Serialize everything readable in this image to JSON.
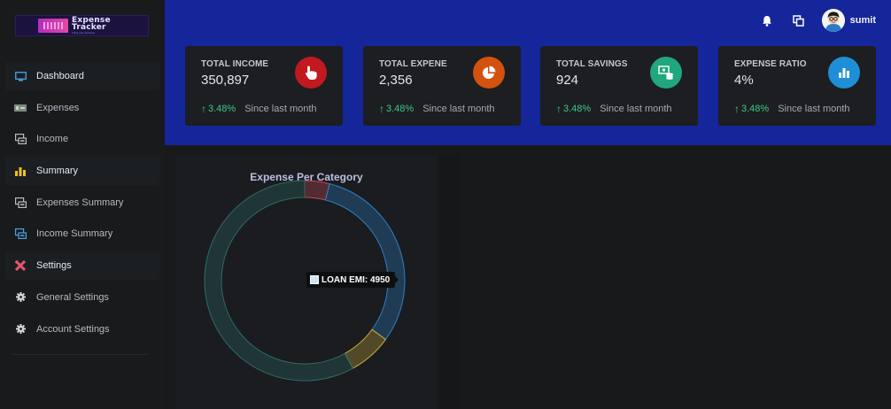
{
  "app": {
    "logo_line1": "Expense",
    "logo_line2": "Tracker",
    "logo_tagline": "Track your finances"
  },
  "sidebar": {
    "items": [
      {
        "label": "Dashboard",
        "icon": "monitor-icon",
        "head": true
      },
      {
        "label": "Expenses",
        "icon": "cash-icon",
        "head": false
      },
      {
        "label": "Income",
        "icon": "money-transfer-icon",
        "head": false
      },
      {
        "label": "Summary",
        "icon": "bar-chart-icon",
        "head": true
      },
      {
        "label": "Expenses Summary",
        "icon": "money-transfer-icon",
        "head": false
      },
      {
        "label": "Income Summary",
        "icon": "money-transfer-icon",
        "head": false
      },
      {
        "label": "Settings",
        "icon": "tools-icon",
        "head": true
      },
      {
        "label": "General Settings",
        "icon": "gear-icon",
        "head": false
      },
      {
        "label": "Account Settings",
        "icon": "gear-icon",
        "head": false
      }
    ]
  },
  "header": {
    "username": "sumit",
    "icons": [
      "bell-icon",
      "window-restore-icon",
      "avatar"
    ]
  },
  "cards": [
    {
      "title": "TOTAL INCOME",
      "value": "350,897",
      "change": "3.48%",
      "since": "Since last month",
      "icon": "hand-pointer-icon",
      "color": "#c0191f"
    },
    {
      "title": "TOTAL EXPENE",
      "value": "2,356",
      "change": "3.48%",
      "since": "Since last month",
      "icon": "pie-chart-icon",
      "color": "#d4520f"
    },
    {
      "title": "TOTAL SAVINGS",
      "value": "924",
      "change": "3.48%",
      "since": "Since last month",
      "icon": "money-stack-icon",
      "color": "#20a77e"
    },
    {
      "title": "EXPENSE RATIO",
      "value": "4%",
      "change": "3.48%",
      "since": "Since last month",
      "icon": "bar-chart-icon",
      "color": "#1e8fd6"
    }
  ],
  "chart": {
    "title": "Expense Per Category",
    "tooltip_label": "LOAN EMI: 4950"
  },
  "chart_data": {
    "type": "pie",
    "title": "Expense Per Category",
    "slices": [
      {
        "label": "",
        "fraction": 0.04,
        "color": "#c94b5c"
      },
      {
        "label": "LOAN EMI",
        "value": 4950,
        "fraction": 0.31,
        "color": "#2f7fc4"
      },
      {
        "label": "",
        "fraction": 0.07,
        "color": "#c9a83b"
      },
      {
        "label": "",
        "fraction": 0.58,
        "color": "#2f6a66"
      }
    ]
  }
}
